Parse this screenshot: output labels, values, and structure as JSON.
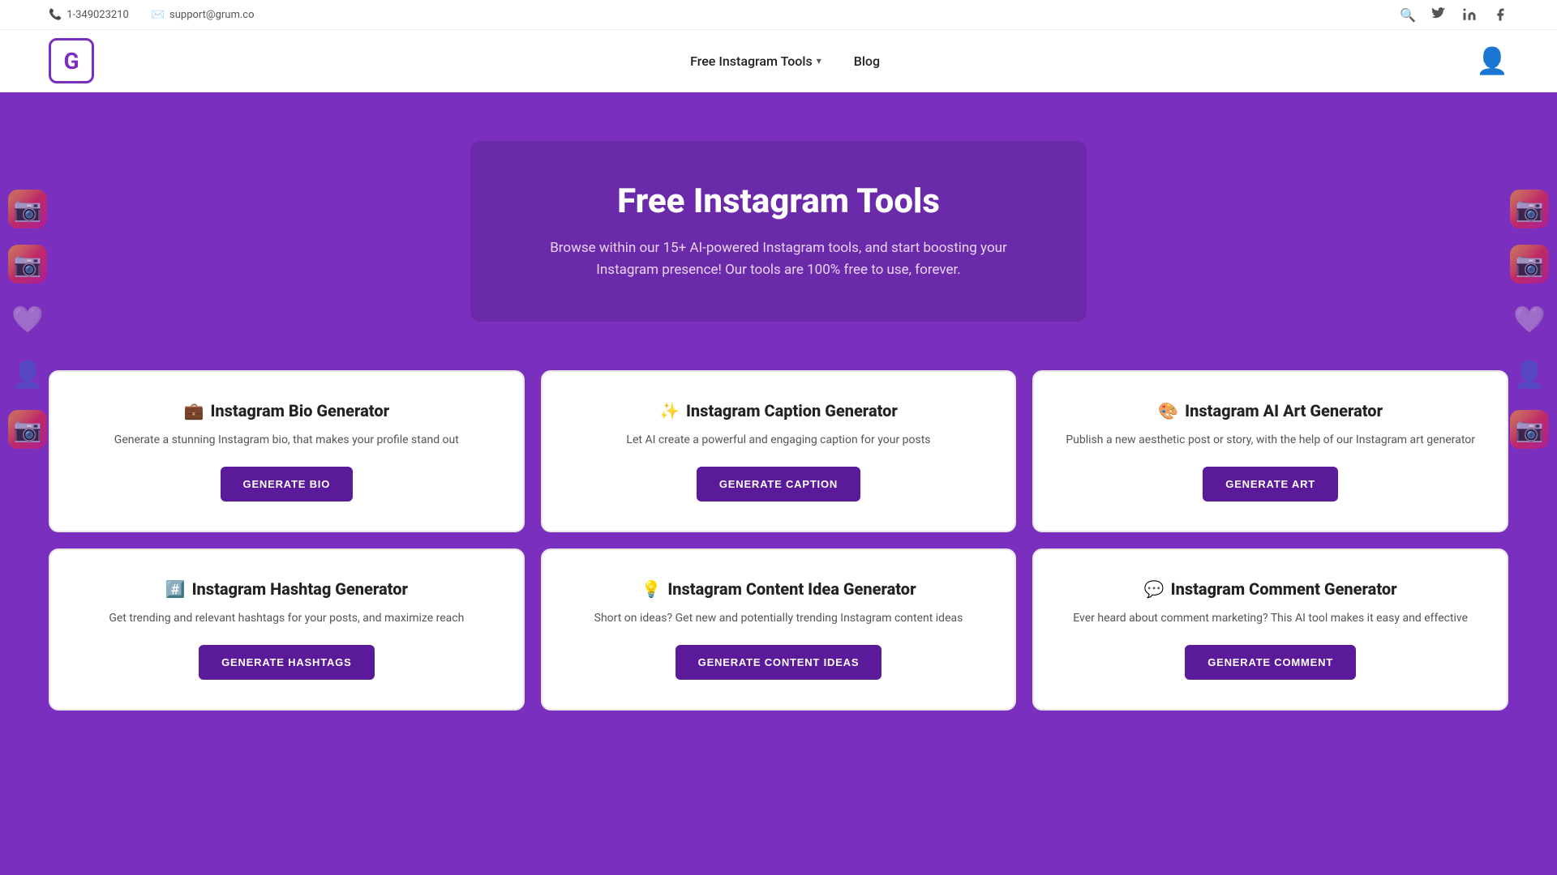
{
  "topbar": {
    "phone": "1-349023210",
    "email": "support@grum.co",
    "icons": [
      "search",
      "twitter",
      "linkedin",
      "facebook"
    ]
  },
  "nav": {
    "logo_letter": "G",
    "tools_label": "Free Instagram Tools",
    "blog_label": "Blog"
  },
  "hero": {
    "title": "Free Instagram Tools",
    "subtitle": "Browse within our 15+ AI-powered Instagram tools, and start boosting your Instagram presence! Our tools are 100% free to use, forever."
  },
  "cards": [
    {
      "emoji": "💼",
      "title": "Instagram Bio Generator",
      "desc": "Generate a stunning Instagram bio, that makes your profile stand out",
      "btn": "GENERATE BIO"
    },
    {
      "emoji": "✨",
      "title": "Instagram Caption Generator",
      "desc": "Let AI create a powerful and engaging caption for your posts",
      "btn": "GENERATE CAPTION"
    },
    {
      "emoji": "🎨",
      "title": "Instagram AI Art Generator",
      "desc": "Publish a new aesthetic post or story, with the help of our Instagram art generator",
      "btn": "GENERATE ART"
    },
    {
      "emoji": "#️⃣",
      "title": "Instagram Hashtag Generator",
      "desc": "Get trending and relevant hashtags for your posts, and maximize reach",
      "btn": "GENERATE HASHTAGS"
    },
    {
      "emoji": "💡",
      "title": "Instagram Content Idea Generator",
      "desc": "Short on ideas? Get new and potentially trending Instagram content ideas",
      "btn": "GENERATE CONTENT IDEAS"
    },
    {
      "emoji": "💬",
      "title": "Instagram Comment Generator",
      "desc": "Ever heard about comment marketing? This AI tool makes it easy and effective",
      "btn": "GENERATE COMMENT"
    }
  ]
}
